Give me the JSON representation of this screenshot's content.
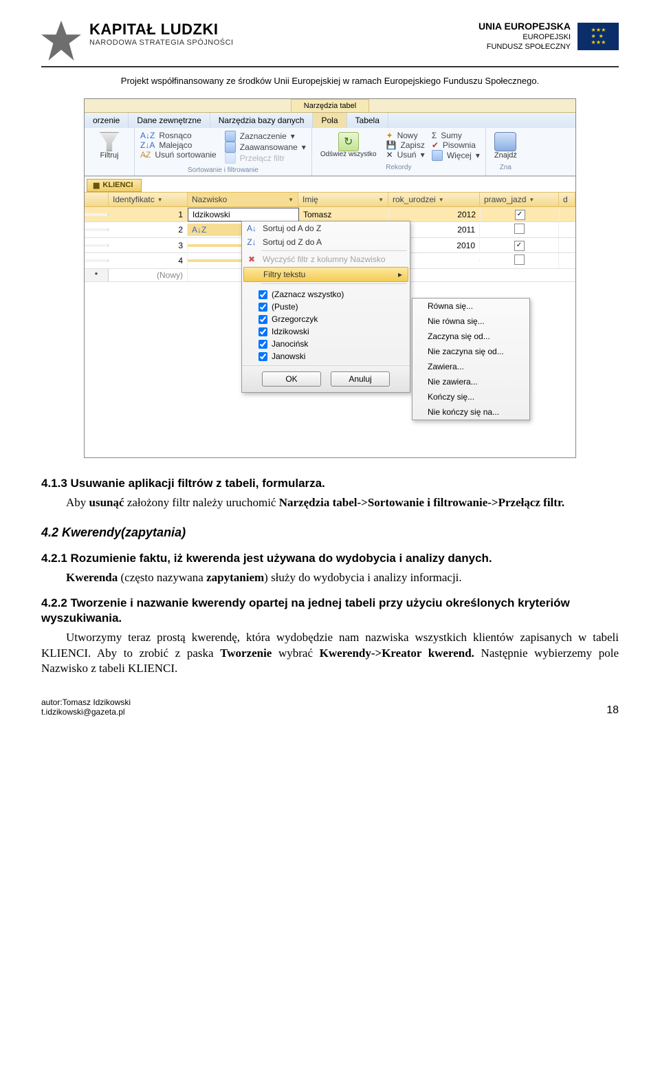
{
  "header": {
    "kl_title": "KAPITAŁ LUDZKI",
    "kl_sub": "NARODOWA STRATEGIA SPÓJNOŚCI",
    "eu_title": "UNIA EUROPEJSKA",
    "eu_sub1": "EUROPEJSKI",
    "eu_sub2": "FUNDUSZ SPOŁECZNY",
    "project_line": "Projekt współfinansowany ze środków Unii Europejskiej w ramach Europejskiego Funduszu Społecznego."
  },
  "ribbon": {
    "context_tab": "Narzędzia tabel",
    "tabs": [
      "orzenie",
      "Dane zewnętrzne",
      "Narzędzia bazy danych",
      "Pola",
      "Tabela"
    ],
    "sort": {
      "asc": "Rosnąco",
      "desc": "Malejąco",
      "clear": "Usuń sortowanie",
      "filter_big": "Filtruj"
    },
    "filter": {
      "sel": "Zaznaczenie",
      "adv": "Zaawansowane",
      "toggle": "Przełącz filtr",
      "group": "Sortowanie i filtrowanie"
    },
    "records": {
      "refresh": "Odśwież wszystko",
      "new": "Nowy",
      "save": "Zapisz",
      "del": "Usuń",
      "sum": "Sumy",
      "spell": "Pisownia",
      "more": "Więcej",
      "group": "Rekordy"
    },
    "find": {
      "find": "Znajdź",
      "group": "Zna"
    }
  },
  "table": {
    "tab": "KLIENCI",
    "cols": [
      "Identyfikatc",
      "Nazwisko",
      "Imię",
      "rok_urodzei",
      "prawo_jazd",
      "d"
    ],
    "rows": [
      {
        "id": "1",
        "name": "Idzikowski",
        "imie": "Tomasz",
        "rok": "2012",
        "pj": true
      },
      {
        "id": "2",
        "name": "",
        "imie": "",
        "rok": "2011",
        "pj": false
      },
      {
        "id": "3",
        "name": "",
        "imie": "",
        "rok": "2010",
        "pj": true
      },
      {
        "id": "4",
        "name": "",
        "imie": "",
        "rok": "",
        "pj": false
      }
    ],
    "new": "(Nowy)"
  },
  "ctx": {
    "sort_az": "Sortuj od A do Z",
    "sort_za": "Sortuj od Z do A",
    "clear": "Wyczyść filtr z kolumny Nazwisko",
    "text_filters": "Filtry tekstu",
    "checks": [
      "(Zaznacz wszystko)",
      "(Puste)",
      "Grzegorczyk",
      "Idzikowski",
      "Janocińsk",
      "Janowski"
    ],
    "ok": "OK",
    "cancel": "Anuluj"
  },
  "submenu": [
    "Równa się...",
    "Nie równa się...",
    "Zaczyna się od...",
    "Nie zaczyna się od...",
    "Zawiera...",
    "Nie zawiera...",
    "Kończy się...",
    "Nie kończy się na..."
  ],
  "doc": {
    "h1": "4.1.3 Usuwanie aplikacji filtrów z tabeli, formularza.",
    "p1a": "Aby ",
    "p1b": "usunąć",
    "p1c": " założony filtr należy uruchomić ",
    "p1d": "Narzędzia tabel->Sortowanie i filtrowanie->Przełącz filtr.",
    "h2": "4.2 Kwerendy(zapytania)",
    "h3": "4.2.1 Rozumienie faktu, iż kwerenda jest używana do wydobycia i analizy danych.",
    "p2a": "Kwerenda",
    "p2b": " (często nazywana ",
    "p2c": "zapytaniem",
    "p2d": ") służy do wydobycia i analizy informacji.",
    "h4": "4.2.2 Tworzenie i nazwanie kwerendy opartej na jednej tabeli przy użyciu określonych kryteriów wyszukiwania.",
    "p3": "Utworzymy teraz prostą kwerendę, która wydobędzie nam nazwiska wszystkich klientów zapisanych w tabeli KLIENCI. Aby to zrobić z paska ",
    "p3b": "Tworzenie",
    "p3c": " wybrać ",
    "p3d": "Kwerendy->Kreator kwerend.",
    "p3e": " Następnie wybierzemy pole Nazwisko z tabeli KLIENCI."
  },
  "footer": {
    "a1": "autor:Tomasz Idzikowski",
    "a2": "t.idzikowski@gazeta.pl",
    "page": "18"
  }
}
